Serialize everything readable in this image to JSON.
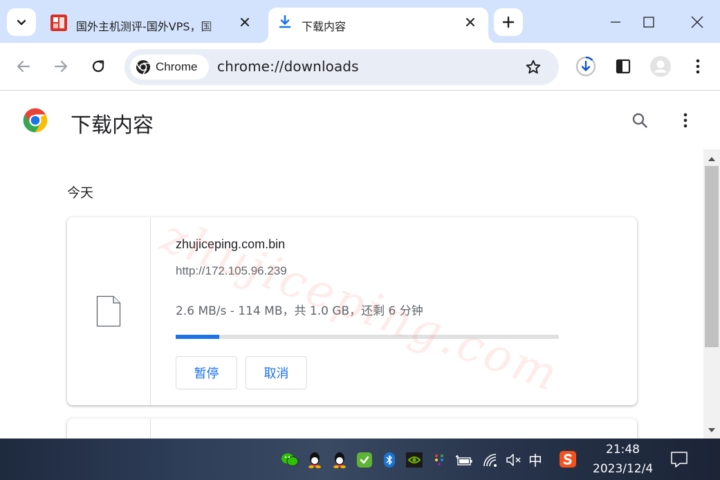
{
  "tabs": [
    {
      "title": "国外主机测评-国外VPS，国",
      "active": false
    },
    {
      "title": "下载内容",
      "active": true
    }
  ],
  "toolbar": {
    "chip_label": "Chrome",
    "url": "chrome://downloads"
  },
  "page": {
    "title": "下载内容",
    "date_header": "今天",
    "watermark": "zhujiceping.com"
  },
  "download": {
    "file_name": "zhujiceping.com.bin",
    "source_url": "http://172.105.96.239",
    "status": "2.6 MB/s - 114 MB，共 1.0 GB，还剩 6 分钟",
    "progress_fraction": 0.114,
    "pause_label": "暂停",
    "cancel_label": "取消"
  },
  "taskbar": {
    "ime": "中",
    "time": "21:48",
    "date": "2023/12/4"
  },
  "colors": {
    "accent": "#1a73e8",
    "tabstrip": "#d3e3fd",
    "omnibox": "#e9eef6"
  },
  "icons": [
    "tab-search-icon",
    "download-icon",
    "close-icon",
    "plus-icon",
    "minimize-icon",
    "maximize-icon",
    "back-icon",
    "forward-icon",
    "reload-icon",
    "chrome-logo-icon",
    "star-icon",
    "download-progress-icon",
    "side-panel-icon",
    "profile-avatar-icon",
    "more-vert-icon",
    "search-icon",
    "file-icon",
    "wechat-icon",
    "qq-icon",
    "shield-icon",
    "bluetooth-icon",
    "nvidia-icon",
    "network-icon",
    "speaker-muted-icon",
    "sogou-icon",
    "notification-icon"
  ]
}
